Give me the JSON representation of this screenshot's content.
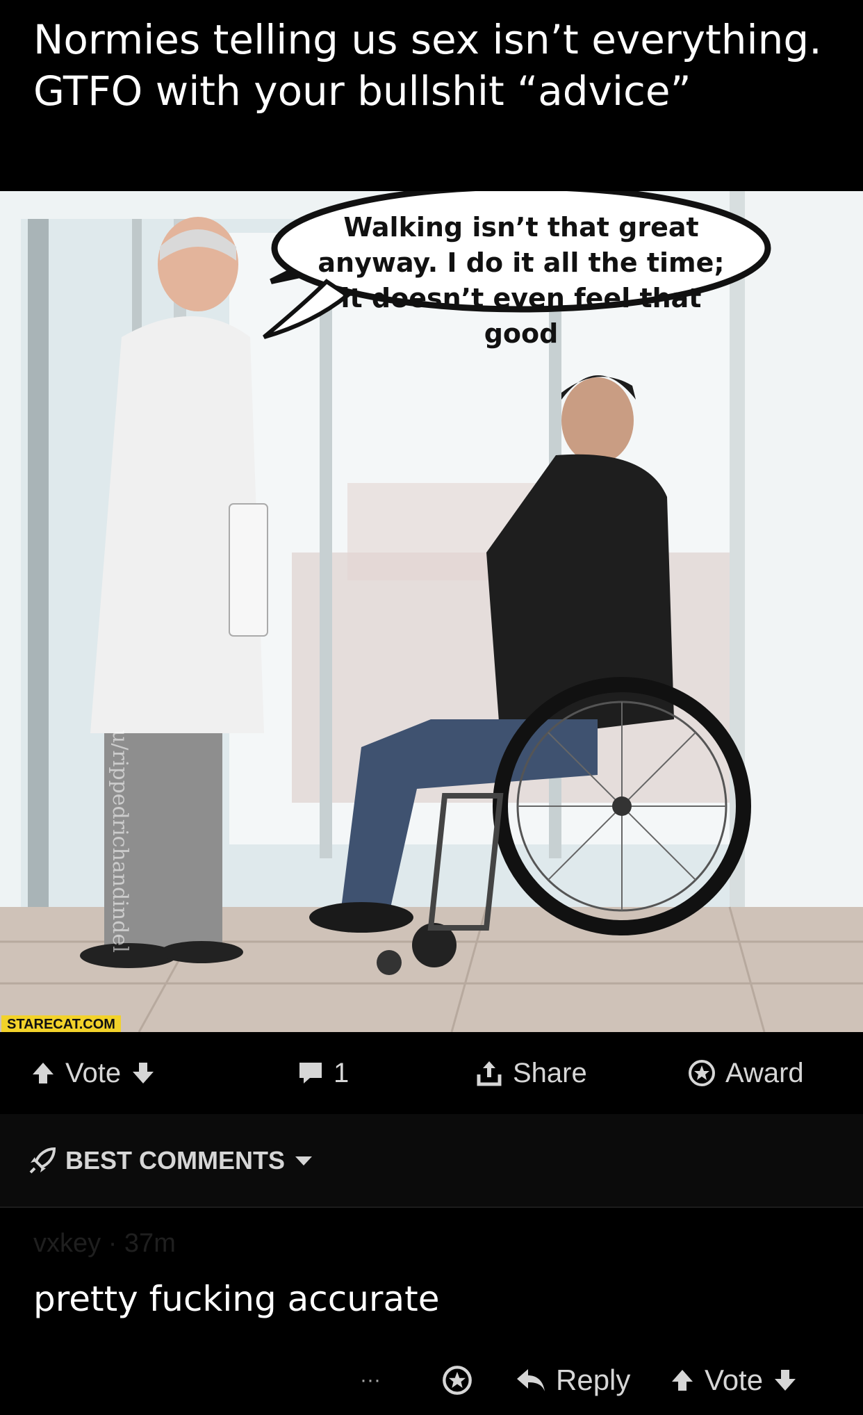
{
  "post": {
    "title": "Normies telling us sex isn’t everything. GTFO with your bullshit “advice”"
  },
  "image": {
    "speech_bubble": "Walking isn’t that great anyway. I do it all the time; it doesn’t even feel that good",
    "watermark_badge": "STARECAT.COM",
    "user_watermark": "u/rippedrichandindel"
  },
  "actions": {
    "vote_label": "Vote",
    "comment_count": "1",
    "share_label": "Share",
    "award_label": "Award"
  },
  "comments": {
    "sort_label": "BEST COMMENTS",
    "items": [
      {
        "author": "vxkey",
        "separator": "·",
        "age": "37m",
        "body": "pretty fucking accurate",
        "more_label": "···",
        "reply_label": "Reply",
        "vote_label": "Vote"
      }
    ]
  },
  "colors": {
    "background": "#000000",
    "text": "#ffffff",
    "muted": "#d6d6d6",
    "badge": "#f2d22a"
  }
}
